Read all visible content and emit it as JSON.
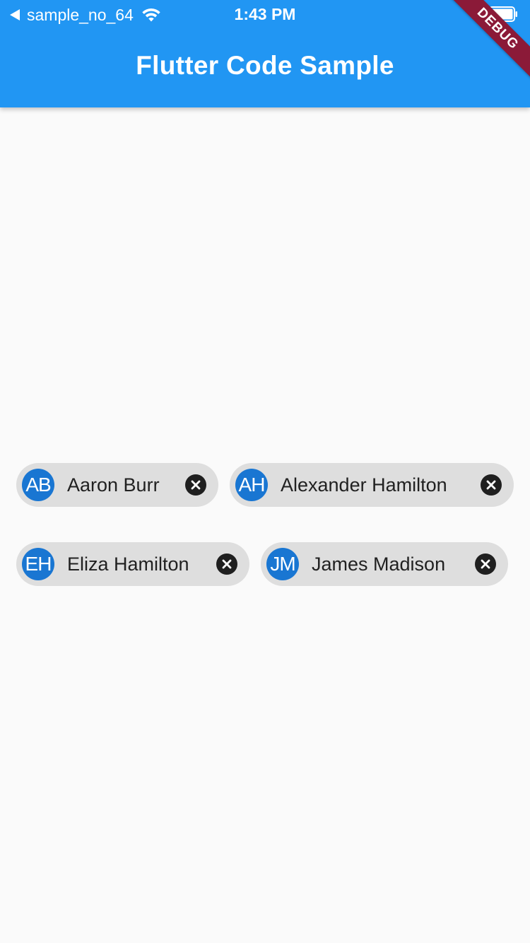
{
  "status_bar": {
    "back_app": "sample_no_64",
    "time": "1:43 PM"
  },
  "app_bar": {
    "title": "Flutter Code Sample",
    "background": "#2196f3"
  },
  "debug_banner": {
    "label": "DEBUG",
    "color": "#8b1a38"
  },
  "chips": [
    {
      "initials": "AB",
      "name": "Aaron Burr"
    },
    {
      "initials": "AH",
      "name": "Alexander Hamilton"
    },
    {
      "initials": "EH",
      "name": "Eliza Hamilton"
    },
    {
      "initials": "JM",
      "name": "James Madison"
    }
  ],
  "colors": {
    "chip_background": "#dedede",
    "avatar": "#1976d2",
    "page_background": "#fafafa"
  },
  "icons": {
    "back": "back-arrow-icon",
    "wifi": "wifi-icon",
    "battery": "battery-icon",
    "chip_delete": "cancel-circle-icon"
  }
}
